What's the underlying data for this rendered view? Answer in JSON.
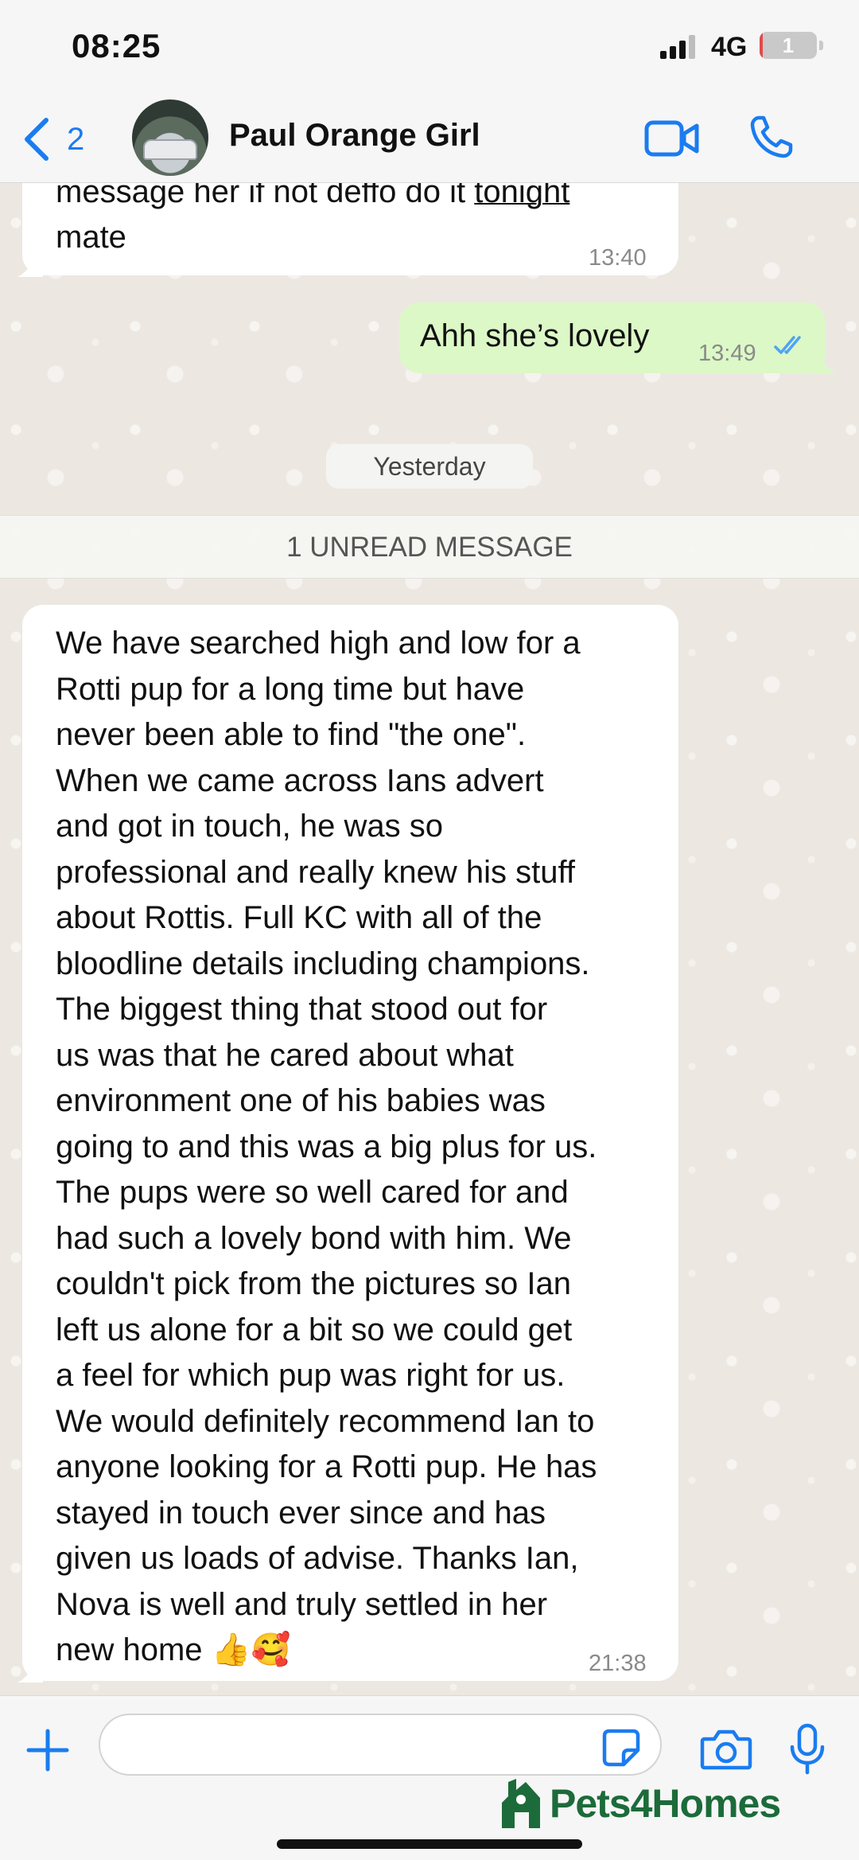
{
  "status_bar": {
    "time": "08:25",
    "network": "4G",
    "battery_level": "1",
    "battery_fraction": 0.05
  },
  "header": {
    "back_count": "2",
    "contact_name": "Paul Orange Girl"
  },
  "messages": [
    {
      "direction": "incoming",
      "lines": [
        "message her if not deffo do it",
        "tonight",
        "mate"
      ],
      "time": "13:40"
    },
    {
      "direction": "outgoing",
      "text": "Ahh she’s lovely",
      "time": "13:49",
      "status": "read"
    },
    {
      "direction": "incoming",
      "lines": [
        "We have searched high and low for a",
        "Rotti pup for a long time but have",
        "never been able to find \"the one\".",
        "When we came across Ians advert",
        "and got in touch, he was so",
        "professional and really knew his stuff",
        "about Rottis. Full KC with all of the",
        "bloodline details including champions.",
        "The biggest thing that stood out for",
        "us was that he cared about what",
        "environment one of his babies was",
        "going to and this was a big plus for us.",
        "The pups were so well cared for and",
        "had such a lovely bond with him. We",
        "couldn't pick from the pictures so Ian",
        "left us alone for a bit so we could get",
        "a feel for which pup was right for us.",
        "We would definitely recommend Ian to",
        "anyone looking for a Rotti pup. He has",
        "stayed in touch ever since and has",
        "given us loads of advise. Thanks Ian,",
        "Nova is well and truly settled in her",
        "new home"
      ],
      "emojis": "👍🥰",
      "time": "21:38"
    }
  ],
  "date_separator": "Yesterday",
  "unread_banner": "1 UNREAD MESSAGE",
  "input": {
    "placeholder": ""
  },
  "watermark": "Pets4Homes",
  "colors": {
    "accent": "#1a7cf0",
    "outgoing_bubble": "#dcf8c6",
    "incoming_bubble": "#ffffff",
    "watermark": "#1c6b3a"
  }
}
